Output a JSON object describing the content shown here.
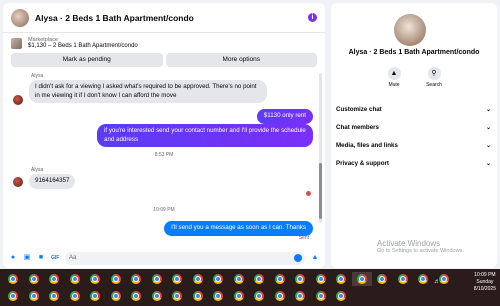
{
  "chat": {
    "title": "Alysa · 2 Beds 1 Bath Apartment/condo",
    "marketplace_label": "Marketplace",
    "marketplace_listing": "$1,130 – 2 Beds 1 Bath Apartment/condo",
    "mark_pending": "Mark as pending",
    "more_options": "More options",
    "sender_1": "Alysa",
    "msg_in_1": "I didn't ask for a viewing I asked what's required to be approved. There's no point in me viewing it if I don't know I can afford the move",
    "msg_out_1": "$1130 only rent",
    "msg_out_2": "if you're interested send your contact number and I'll provide the schedule and address",
    "ts_1": "8:53 PM",
    "sender_2": "Alysa",
    "msg_in_2": "9164164357",
    "ts_2": "10:09 PM",
    "msg_out_3": "I'll send you a message as soon as I can. Thanks",
    "sent": "Sent",
    "composer_placeholder": "Aa"
  },
  "info": {
    "title": "Alysa · 2 Beds 1 Bath Apartment/condo",
    "mute": "Mute",
    "search": "Search",
    "menu": [
      "Customize chat",
      "Chat members",
      "Media, files and links",
      "Privacy & support"
    ]
  },
  "watermark": {
    "line1": "Activate Windows",
    "line2": "Go to Settings to activate Windows."
  },
  "taskbar": {
    "time": "10:09 PM",
    "day": "Sunday",
    "date": "8/10/2025",
    "buttons_row1": 22,
    "buttons_row2": 17
  },
  "colors": {
    "accent": "#7b2ff7",
    "blue": "#0a7cff",
    "taskbar": "#2a1c1a"
  }
}
